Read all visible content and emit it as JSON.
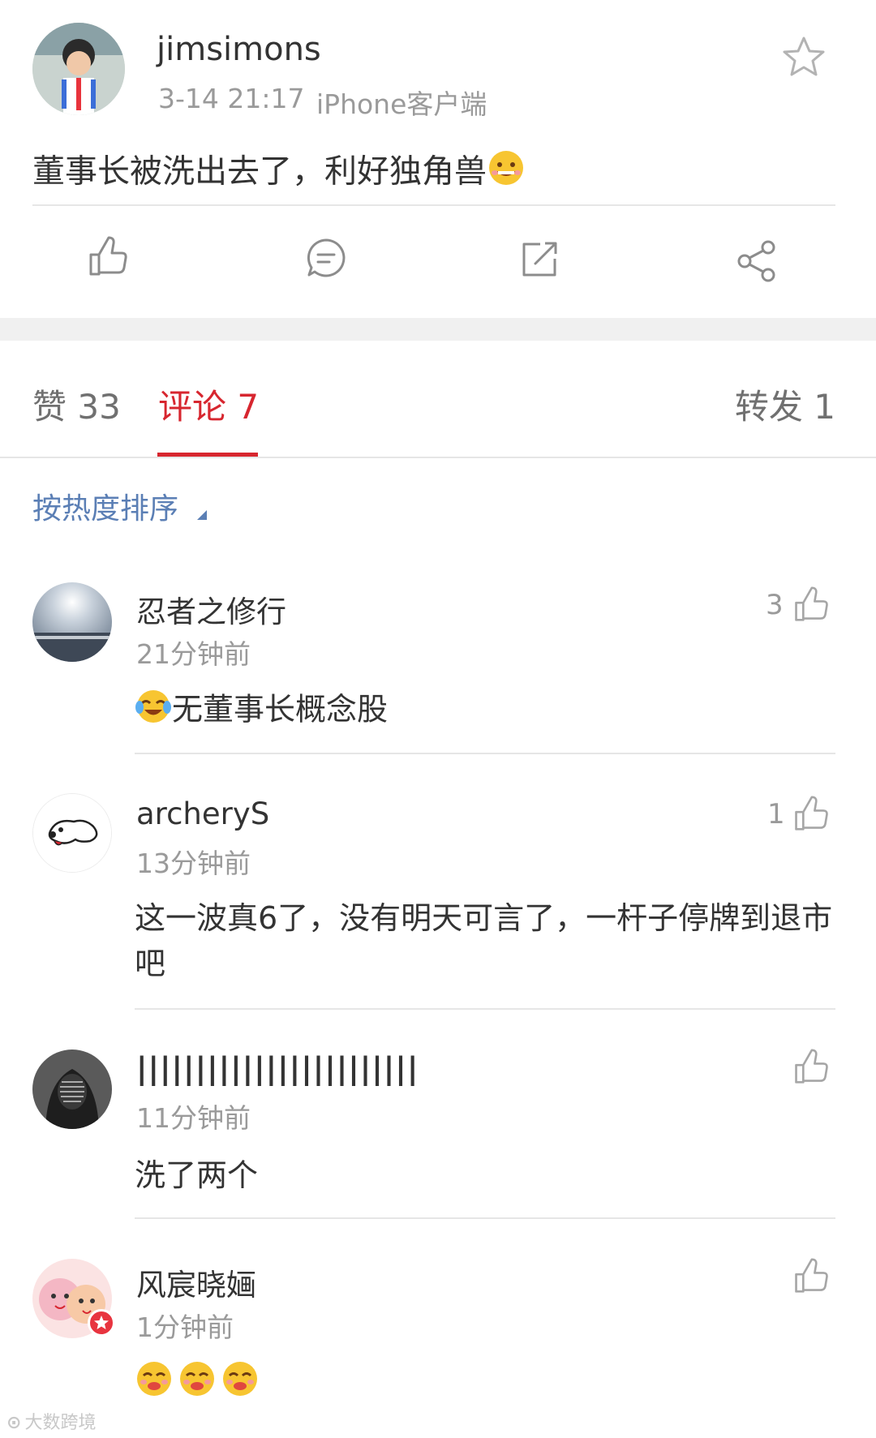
{
  "post": {
    "username": "jimsimons",
    "time": "3-14 21:17",
    "source": "iPhone客户端",
    "text": "董事长被洗出去了，利好独角兽",
    "text_emoji": "grin-sweat-emoji"
  },
  "actions": {
    "like_icon": "thumbs-up-icon",
    "comment_icon": "comment-icon",
    "repost_icon": "repost-icon",
    "share_icon": "share-icon",
    "favorite_icon": "star-icon"
  },
  "tabs": {
    "likes": "赞 33",
    "comments": "评论 7",
    "reposts": "转发 1",
    "active": "comments"
  },
  "sort": {
    "label": "按热度排序"
  },
  "comments": [
    {
      "name": "忍者之修行",
      "time": "21分钟前",
      "text": "无董事长概念股",
      "prefix_emoji": "crying-laughing-emoji",
      "likes": "3"
    },
    {
      "name": "archeryS",
      "time": "13分钟前",
      "text": "这一波真6了，没有明天可言了，一杆子停牌到退市吧",
      "likes": "1"
    },
    {
      "name": "||||||||||||||||||||||||",
      "time": "11分钟前",
      "text": "洗了两个",
      "likes": ""
    },
    {
      "name": "风宸晓婳",
      "time": "1分钟前",
      "text": "",
      "emojis": [
        "drooling-emoji",
        "drooling-emoji",
        "drooling-emoji"
      ],
      "likes": "",
      "verified_badge": true
    }
  ],
  "colors": {
    "accent_red": "#d7262f",
    "sort_blue": "#5b7fb5",
    "muted": "#9a9a9a",
    "text": "#333333"
  },
  "watermark": "大数跨境"
}
